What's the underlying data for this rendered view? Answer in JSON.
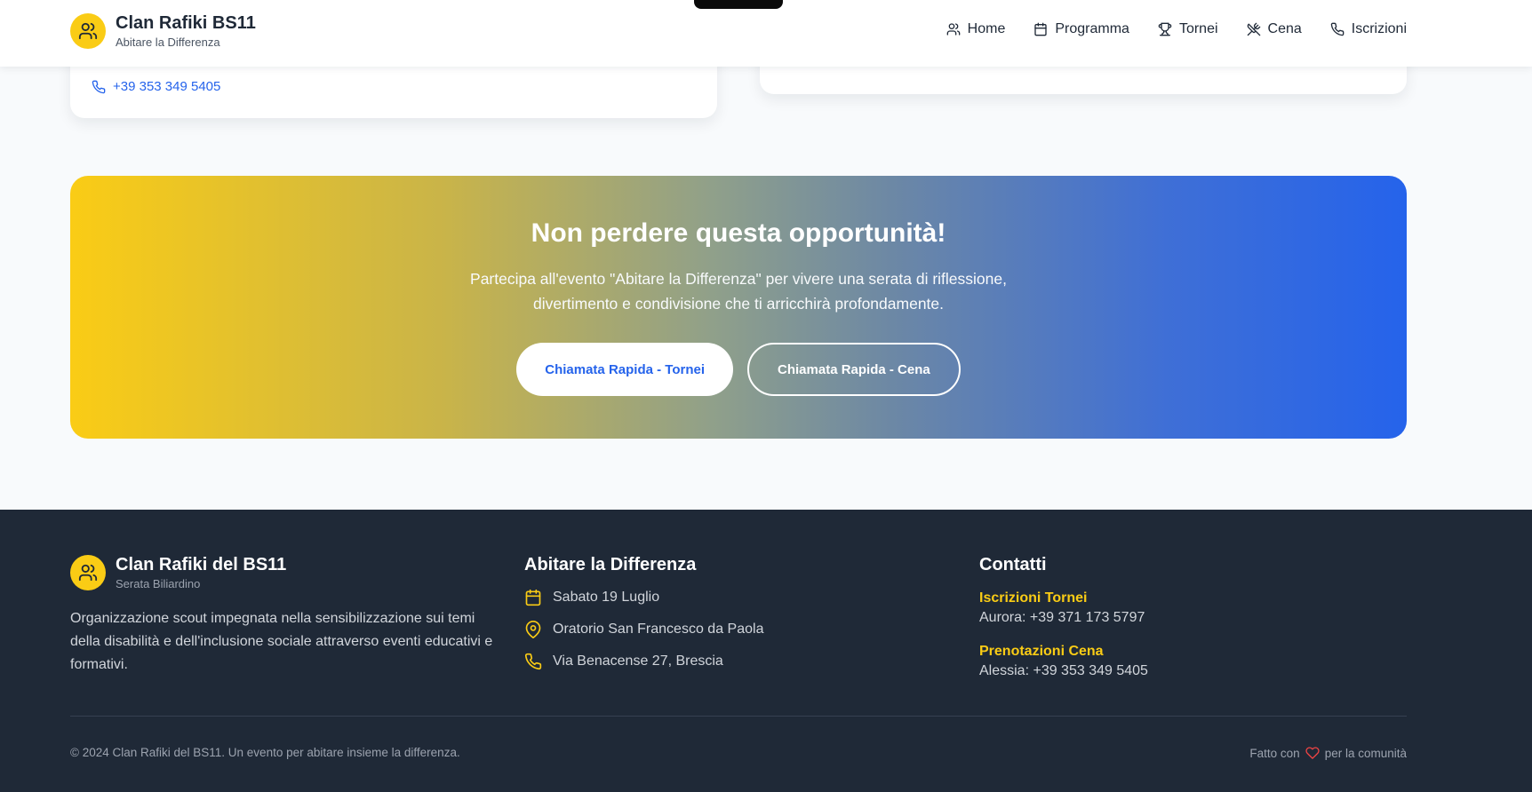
{
  "header": {
    "title": "Clan Rafiki BS11",
    "subtitle": "Abitare la Differenza",
    "nav": [
      {
        "label": "Home",
        "icon": "users-icon"
      },
      {
        "label": "Programma",
        "icon": "calendar-icon"
      },
      {
        "label": "Tornei",
        "icon": "trophy-icon"
      },
      {
        "label": "Cena",
        "icon": "utensils-icon"
      },
      {
        "label": "Iscrizioni",
        "icon": "phone-icon"
      }
    ]
  },
  "cards": {
    "left_phone": "+39 353 349 5405"
  },
  "cta": {
    "title": "Non perdere questa opportunità!",
    "text_line1": "Partecipa all'evento \"Abitare la Differenza\" per vivere una serata di riflessione,",
    "text_line2": "divertimento e condivisione che ti arricchirà profondamente.",
    "primary_button": "Chiamata Rapida - Tornei",
    "secondary_button": "Chiamata Rapida - Cena"
  },
  "footer": {
    "brand_title": "Clan Rafiki del BS11",
    "brand_subtitle": "Serata Biliardino",
    "description": "Organizzazione scout impegnata nella sensibilizzazione sui temi della disabilità e dell'inclusione sociale attraverso eventi educativi e formativi.",
    "event_heading": "Abitare la Differenza",
    "event_items": [
      {
        "text": "Sabato 19 Luglio",
        "icon": "calendar-icon"
      },
      {
        "text": "Oratorio San Francesco da Paola",
        "icon": "map-pin-icon"
      },
      {
        "text": "Via Benacense 27, Brescia",
        "icon": "phone-icon"
      }
    ],
    "contacts_heading": "Contatti",
    "contacts": [
      {
        "label": "Iscrizioni Tornei",
        "value": "Aurora: +39 371 173 5797"
      },
      {
        "label": "Prenotazioni Cena",
        "value": "Alessia: +39 353 349 5405"
      }
    ],
    "copyright": "© 2024 Clan Rafiki del BS11. Un evento per abitare insieme la differenza.",
    "made_with_prefix": "Fatto con",
    "made_with_suffix": "per la comunità"
  },
  "colors": {
    "accent_yellow": "#facc15",
    "accent_blue": "#2563eb",
    "footer_bg": "#1f2937"
  }
}
